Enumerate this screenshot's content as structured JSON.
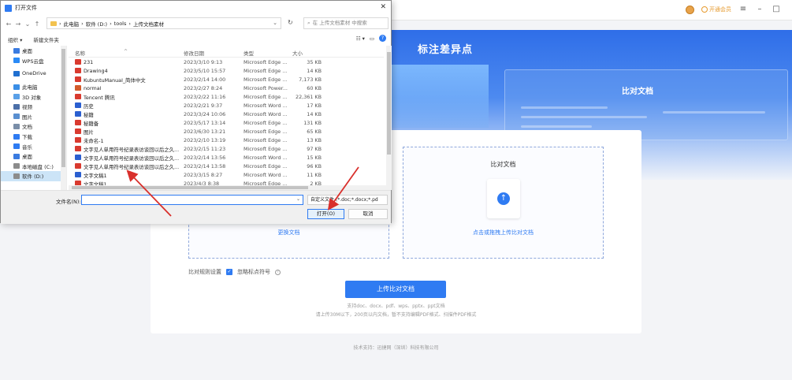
{
  "app": {
    "vip_label": "开通会员",
    "banner_title": "标注差异点",
    "banner_compare_label": "比对文档",
    "compare_box_title": "比对文档",
    "left_upload_link": "更换文档",
    "right_upload_link": "点击或拖拽上传比对文档",
    "rules_label": "比对规则设置",
    "ignore_punct_label": "忽略标点符号",
    "upload_button": "上传比对文档",
    "hint_formats": "支持doc、docx、pdf、wps、pptx、ppt文档",
    "hint_limits": "请上传30M以下，200页以内文档，暂不支持编辑PDF格式、扫描件PDF格式",
    "footer": "技术支持：迅捷网（深圳）科技有限公司",
    "accent_color": "#2f7bf2"
  },
  "dialog": {
    "title": "打开文件",
    "breadcrumb": [
      "此电脑",
      "软件 (D:)",
      "tools",
      "上传文档素材"
    ],
    "search_placeholder": "在 上传文档素材 中搜索",
    "toolbar": {
      "organize": "组织 ▾",
      "new_folder": "新建文件夹"
    },
    "nav_items": [
      {
        "label": "桌面",
        "icon": "desktop-icon",
        "color": "#3a7be0"
      },
      {
        "label": "WPS云盘",
        "icon": "cloud-icon",
        "color": "#2a8af6"
      },
      {
        "label": "OneDrive",
        "icon": "cloud-icon",
        "color": "#1f6fd0"
      },
      {
        "label": "此电脑",
        "icon": "computer-icon",
        "color": "#3a8ee6"
      },
      {
        "label": "3D 对象",
        "icon": "cube-icon",
        "color": "#5aa0e8"
      },
      {
        "label": "视频",
        "icon": "video-icon",
        "color": "#4c6fa8"
      },
      {
        "label": "图片",
        "icon": "picture-icon",
        "color": "#5a8fd0"
      },
      {
        "label": "文档",
        "icon": "document-icon",
        "color": "#7a8ea8"
      },
      {
        "label": "下载",
        "icon": "download-icon",
        "color": "#2f7bf2"
      },
      {
        "label": "音乐",
        "icon": "music-icon",
        "color": "#2f7bf2"
      },
      {
        "label": "桌面",
        "icon": "desktop-icon",
        "color": "#3a7be0"
      },
      {
        "label": "本地磁盘 (C:)",
        "icon": "drive-icon",
        "color": "#8c8c8c"
      },
      {
        "label": "软件 (D:)",
        "icon": "drive-icon",
        "color": "#8c8c8c"
      }
    ],
    "columns": {
      "name": "名称",
      "date": "修改日期",
      "type": "类型",
      "size": "大小"
    },
    "files": [
      {
        "name": "231",
        "date": "2023/3/10 9:13",
        "type": "Microsoft Edge ...",
        "size": "35 KB",
        "icon": "pdf-icon"
      },
      {
        "name": "Drawing4",
        "date": "2023/5/10 15:57",
        "type": "Microsoft Edge ...",
        "size": "14 KB",
        "icon": "pdf-icon"
      },
      {
        "name": "KubuntuManual_简体中文",
        "date": "2023/2/14 14:00",
        "type": "Microsoft Edge ...",
        "size": "7,173 KB",
        "icon": "pdf-icon"
      },
      {
        "name": "normal",
        "date": "2023/2/27 8:24",
        "type": "Microsoft Power...",
        "size": "60 KB",
        "icon": "ppt-icon"
      },
      {
        "name": "Tencent 腾讯",
        "date": "2023/2/22 11:16",
        "type": "Microsoft Edge ...",
        "size": "22,361 KB",
        "icon": "pdf-icon"
      },
      {
        "name": "历史",
        "date": "2023/2/21 9:37",
        "type": "Microsoft Word ...",
        "size": "17 KB",
        "icon": "word-icon"
      },
      {
        "name": "秘籍",
        "date": "2023/3/24 10:06",
        "type": "Microsoft Word ...",
        "size": "14 KB",
        "icon": "word-icon"
      },
      {
        "name": "秘籍备",
        "date": "2023/5/17 13:14",
        "type": "Microsoft Edge ...",
        "size": "131 KB",
        "icon": "pdf-icon"
      },
      {
        "name": "图片",
        "date": "2023/6/30 13:21",
        "type": "Microsoft Edge ...",
        "size": "65 KB",
        "icon": "pdf-icon"
      },
      {
        "name": "未命名-1",
        "date": "2023/2/10 13:19",
        "type": "Microsoft Edge ...",
        "size": "13 KB",
        "icon": "pdf-icon"
      },
      {
        "name": "文字见人单用符号纪录表访谈回以后之久...",
        "date": "2023/2/15 11:23",
        "type": "Microsoft Edge ...",
        "size": "97 KB",
        "icon": "pdf-icon"
      },
      {
        "name": "文字见人单用符号纪录表访谈回以后之久...",
        "date": "2023/2/14 13:56",
        "type": "Microsoft Word ...",
        "size": "15 KB",
        "icon": "word-icon"
      },
      {
        "name": "文字见人单用符号纪录表访谈回以后之久...",
        "date": "2023/2/14 13:58",
        "type": "Microsoft Edge ...",
        "size": "96 KB",
        "icon": "pdf-icon"
      },
      {
        "name": "文字文稿1",
        "date": "2023/3/15 8:27",
        "type": "Microsoft Word ...",
        "size": "11 KB",
        "icon": "word-icon"
      },
      {
        "name": "文字文稿1",
        "date": "2023/4/3 8:38",
        "type": "Microsoft Edge ...",
        "size": "2 KB",
        "icon": "pdf-icon"
      }
    ],
    "filename_label": "文件名(N):",
    "filename_value": "",
    "filetype_value": "自定义文件 (*.doc;*.docx;*.pd",
    "open_button": "打开(O)",
    "cancel_button": "取消"
  }
}
